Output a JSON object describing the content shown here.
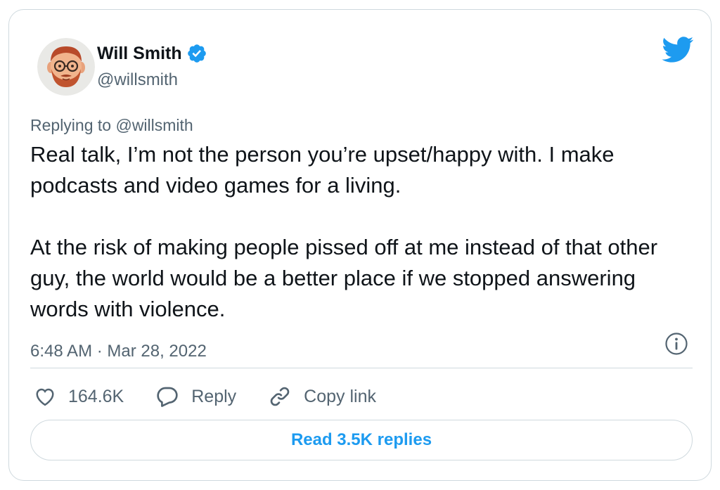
{
  "author": {
    "name": "Will Smith",
    "handle": "@willsmith",
    "verified": true
  },
  "icons": {
    "avatar": "avatar-memoji",
    "verified": "verified-badge-icon",
    "brand": "twitter-bird-icon",
    "info": "info-icon",
    "like": "heart-icon",
    "reply": "speech-bubble-icon",
    "copy": "link-icon"
  },
  "tweet": {
    "replying_prefix": "Replying to ",
    "replying_handle": "@willsmith",
    "paragraphs": [
      "Real talk, I’m not the person you’re upset/happy with. I make podcasts and video games for a living.",
      "At the risk of making people pissed off at me instead of that other guy, the world would be a better place if we stopped answering words with violence."
    ],
    "timestamp": "6:48 AM · Mar 28, 2022"
  },
  "actions": {
    "likes": "164.6K",
    "reply_label": "Reply",
    "copy_label": "Copy link"
  },
  "read_replies": "Read 3.5K replies",
  "colors": {
    "accent": "#1d9bf0",
    "text": "#0f1419",
    "muted": "#536471",
    "border": "#cfd9de"
  }
}
